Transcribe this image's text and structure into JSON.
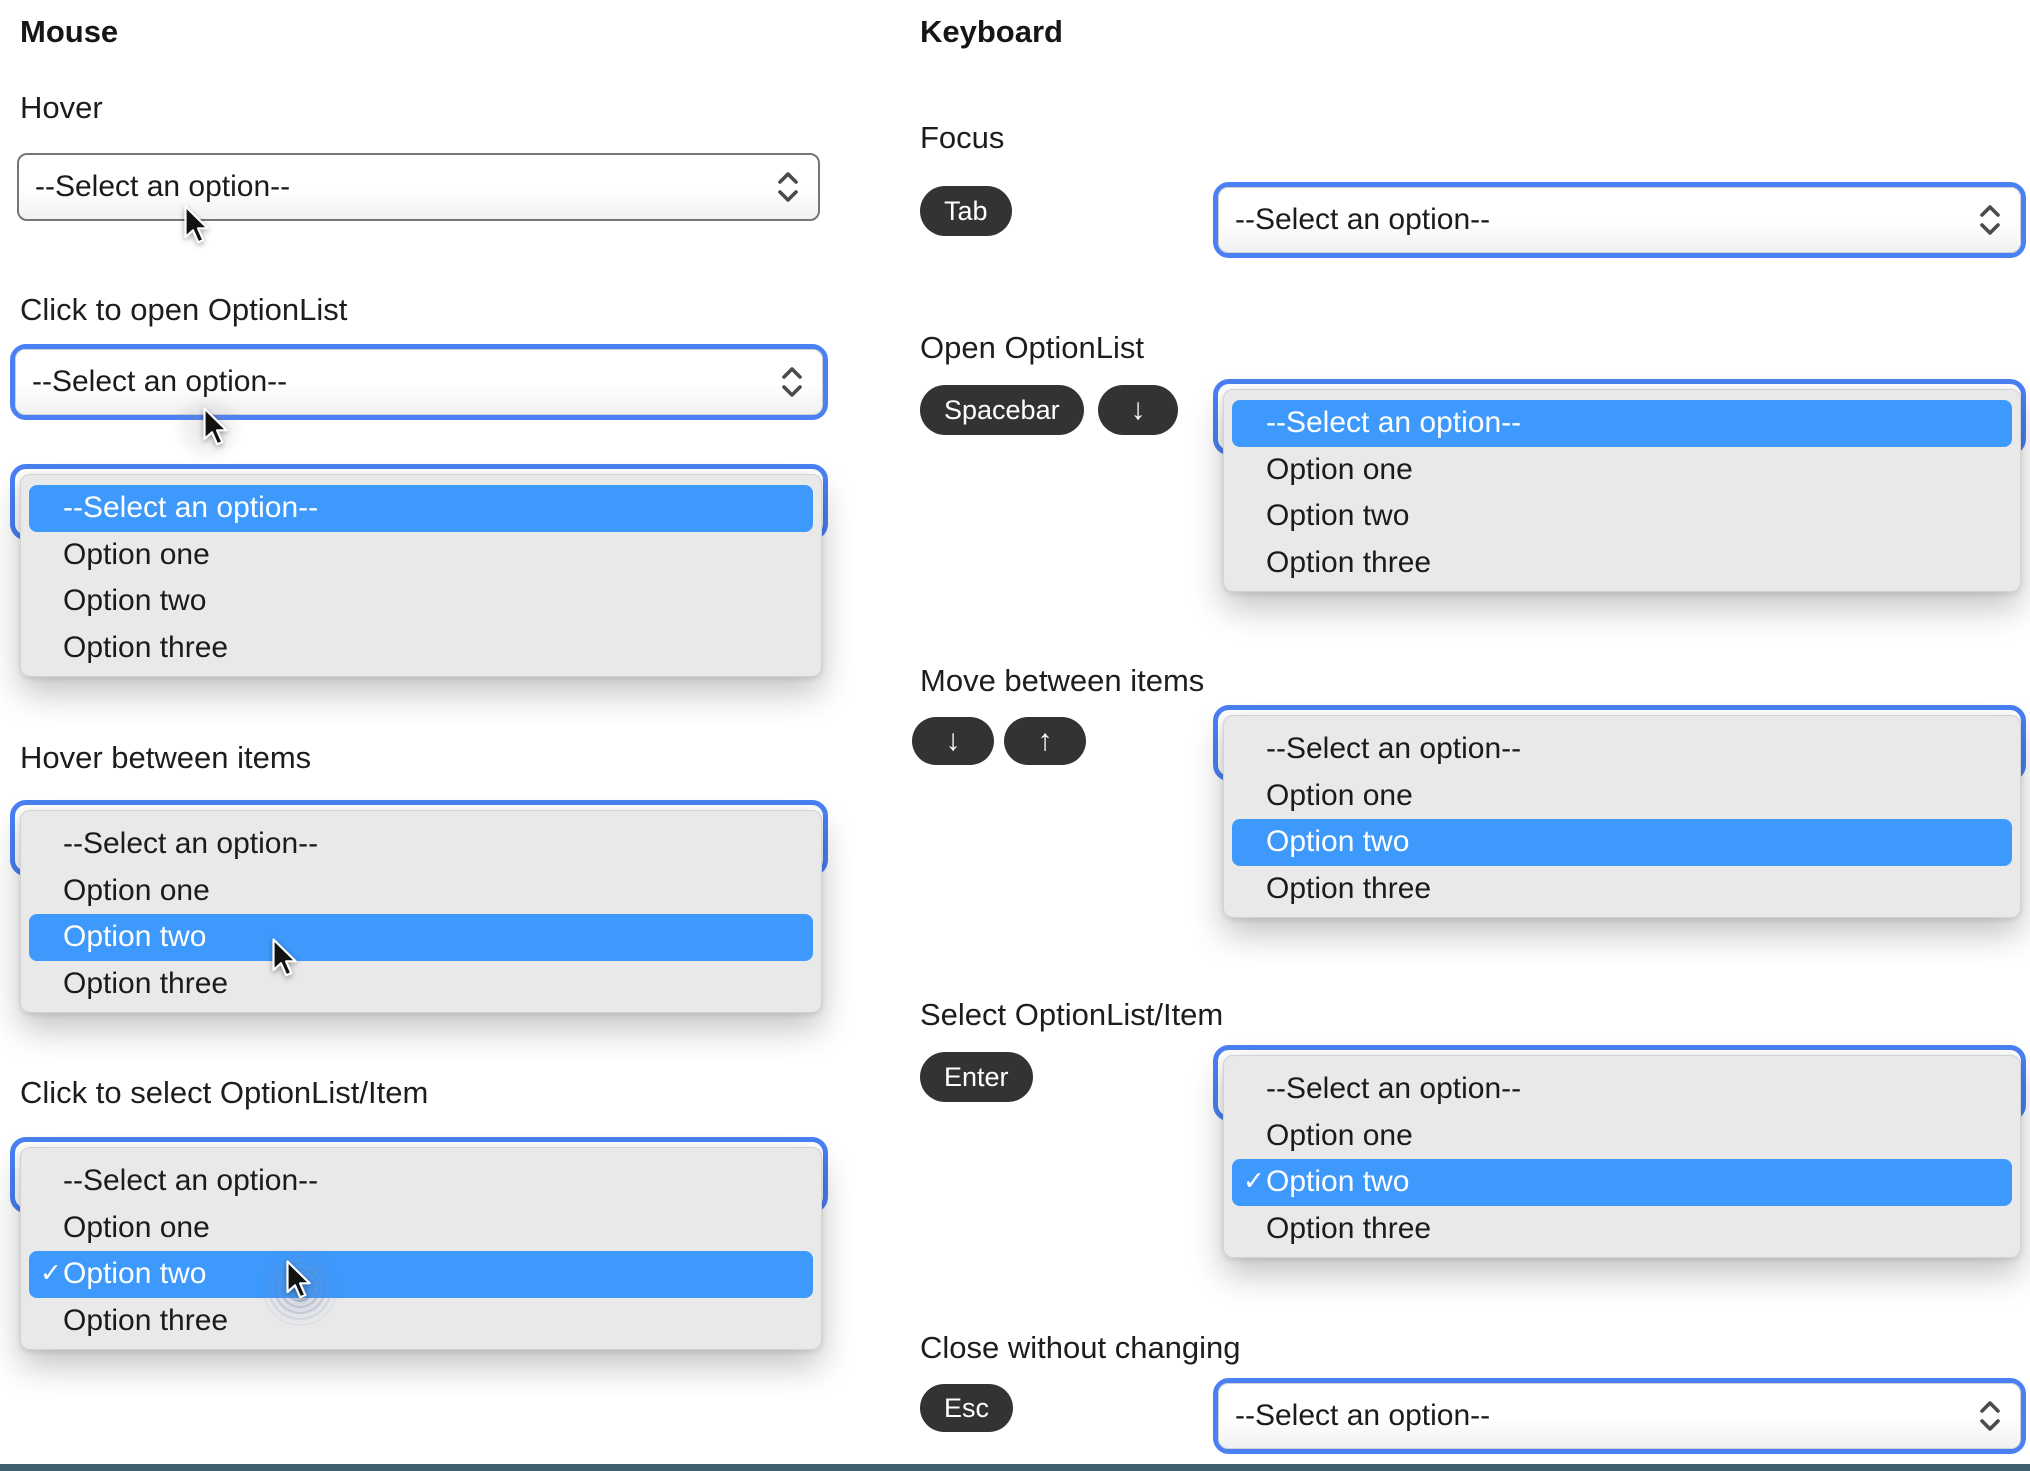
{
  "headings": {
    "mouse": "Mouse",
    "keyboard": "Keyboard"
  },
  "select": {
    "placeholder": "--Select an option--"
  },
  "options": [
    "--Select an option--",
    "Option one",
    "Option two",
    "Option three"
  ],
  "checkmark": "✓",
  "mouse_sections": {
    "hover": {
      "label": "Hover"
    },
    "click_open": {
      "label": "Click to open OptionList"
    },
    "hover_items": {
      "label": "Hover between items"
    },
    "click_select": {
      "label": "Click to select OptionList/Item"
    }
  },
  "keyboard_sections": {
    "focus": {
      "label": "Focus"
    },
    "open": {
      "label": "Open OptionList"
    },
    "move": {
      "label": "Move between items"
    },
    "select_item": {
      "label": "Select OptionList/Item"
    },
    "close": {
      "label": "Close without changing"
    }
  },
  "keys": {
    "tab": "Tab",
    "spacebar": "Spacebar",
    "down": "↓",
    "up": "↑",
    "enter": "Enter",
    "esc": "Esc"
  },
  "colors": {
    "item_highlight": "#3d99fc",
    "focus_ring": "#4a80f4",
    "panel_bg": "#e9e9ea",
    "key_badge_bg": "#323335",
    "bottom_bar": "#42606e"
  }
}
